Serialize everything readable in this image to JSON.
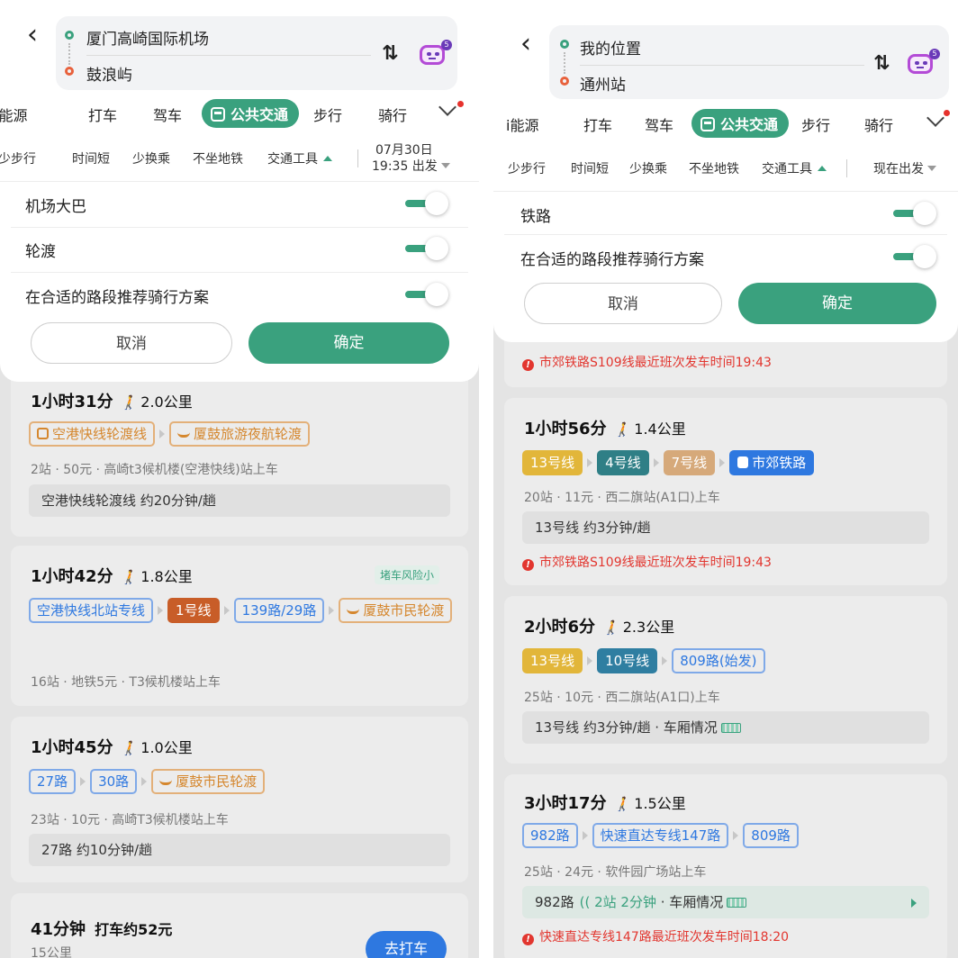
{
  "left": {
    "origin": "厦门高崎国际机场",
    "destination": "鼓浪屿",
    "badge": "5",
    "modes": [
      "i能源",
      "打车",
      "驾车",
      "公共交通",
      "步行",
      "骑行"
    ],
    "filters": [
      "少步行",
      "时间短",
      "少换乘",
      "不坐地铁",
      "交通工具"
    ],
    "depart_date": "07月30日",
    "depart_time": "19:35 出发",
    "toggles": [
      "机场大巴",
      "轮渡",
      "在合适的路段推荐骑行方案"
    ],
    "cancel": "取消",
    "confirm": "确定",
    "routes": [
      {
        "time": "1小时31分",
        "walk": "2.0公里",
        "chips": [
          "空港快线轮渡线",
          "厦鼓旅游夜航轮渡"
        ],
        "info": "2站 · 50元 · 高崎t3候机楼(空港快线)站上车",
        "strip": "空港快线轮渡线 约20分钟/趟"
      },
      {
        "time": "1小时42分",
        "walk": "1.8公里",
        "risk": "堵车风险小",
        "chips": [
          "空港快线北站专线",
          "1号线",
          "139路/29路",
          "厦鼓市民轮渡"
        ],
        "info": "16站 · 地铁5元 · T3候机楼站上车"
      },
      {
        "time": "1小时45分",
        "walk": "1.0公里",
        "chips": [
          "27路",
          "30路",
          "厦鼓市民轮渡"
        ],
        "info": "23站 · 10元 · 高崎T3候机楼站上车",
        "strip": "27路 约10分钟/趟"
      },
      {
        "time": "41分钟",
        "taxi_text": "打车约52元",
        "sub": "15公里",
        "button": "去打车"
      }
    ]
  },
  "right": {
    "origin": "我的位置",
    "destination": "通州站",
    "badge": "5",
    "modes": [
      "i能源",
      "打车",
      "驾车",
      "公共交通",
      "步行",
      "骑行"
    ],
    "filters": [
      "少步行",
      "时间短",
      "少换乘",
      "不坐地铁",
      "交通工具"
    ],
    "depart": "现在出发",
    "toggles": [
      "铁路",
      "在合适的路段推荐骑行方案"
    ],
    "cancel": "取消",
    "confirm": "确定",
    "top_warning": "市郊铁路S109线最近班次发车时间19:43",
    "routes": [
      {
        "time": "1小时56分",
        "walk": "1.4公里",
        "chips": [
          "13号线",
          "4号线",
          "7号线",
          "市郊铁路"
        ],
        "info": "20站 · 11元 · 西二旗站(A1口)上车",
        "strip": "13号线 约3分钟/趟",
        "warning": "市郊铁路S109线最近班次发车时间19:43"
      },
      {
        "time": "2小时6分",
        "walk": "2.3公里",
        "chips": [
          "13号线",
          "10号线",
          "809路(始发)"
        ],
        "info": "25站 · 10元 · 西二旗站(A1口)上车",
        "strip": "13号线 约3分钟/趟 · 车厢情况"
      },
      {
        "time": "3小时17分",
        "walk": "1.5公里",
        "chips": [
          "982路",
          "快速直达专线147路",
          "809路"
        ],
        "info": "25站 · 24元 · 软件园广场站上车",
        "strip_a": "982路",
        "strip_live": "2站 2分钟",
        "strip_b": " · 车厢情况",
        "warning": "快速直达专线147路最近班次发车时间18:20"
      }
    ]
  },
  "colors": {
    "accent": "#3aa17e",
    "warning": "#e2362f",
    "blue": "#2e78e0",
    "orange": "#d5872e",
    "line13": "#e2b63a",
    "line4": "#2f7f86",
    "line7": "#d6a97a",
    "line10": "#2f7ea1",
    "line1": "#c85d28"
  }
}
